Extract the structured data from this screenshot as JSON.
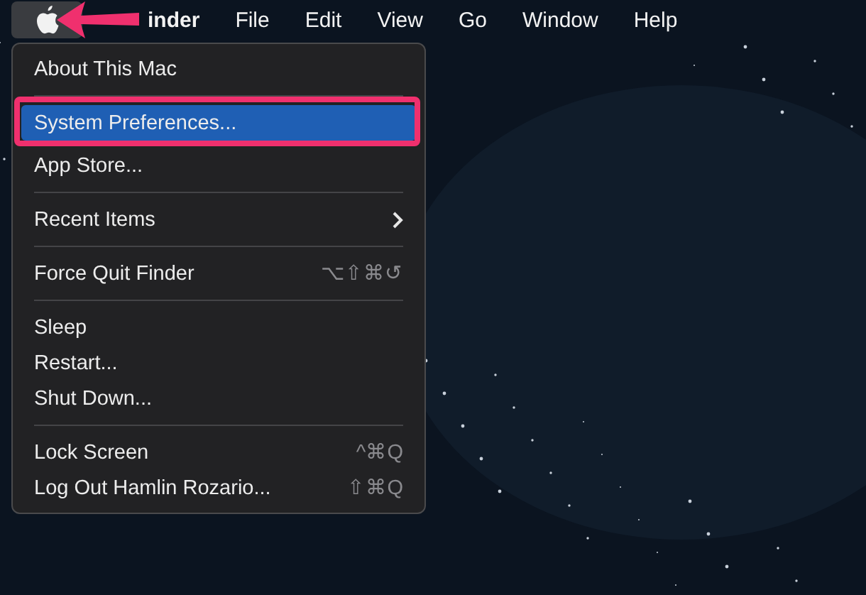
{
  "menu_bar": {
    "apple_selected": true,
    "items": [
      {
        "label": "inder",
        "bold": true
      },
      {
        "label": "File",
        "bold": false
      },
      {
        "label": "Edit",
        "bold": false
      },
      {
        "label": "View",
        "bold": false
      },
      {
        "label": "Go",
        "bold": false
      },
      {
        "label": "Window",
        "bold": false
      },
      {
        "label": "Help",
        "bold": false
      }
    ]
  },
  "apple_menu": {
    "items": [
      {
        "kind": "item",
        "label": "About This Mac",
        "selected": false
      },
      {
        "kind": "separator"
      },
      {
        "kind": "item",
        "label": "System Preferences...",
        "selected": true,
        "annotated": true
      },
      {
        "kind": "item",
        "label": "App Store...",
        "selected": false
      },
      {
        "kind": "separator"
      },
      {
        "kind": "submenu",
        "label": "Recent Items",
        "selected": false
      },
      {
        "kind": "separator"
      },
      {
        "kind": "item",
        "label": "Force Quit Finder",
        "shortcut": "⌥⇧⌘↺",
        "selected": false
      },
      {
        "kind": "separator"
      },
      {
        "kind": "item",
        "label": "Sleep",
        "selected": false
      },
      {
        "kind": "item",
        "label": "Restart...",
        "selected": false
      },
      {
        "kind": "item",
        "label": "Shut Down...",
        "selected": false
      },
      {
        "kind": "separator"
      },
      {
        "kind": "item",
        "label": "Lock Screen",
        "shortcut": "^⌘Q",
        "selected": false
      },
      {
        "kind": "item",
        "label": "Log Out Hamlin Rozario...",
        "shortcut": "⇧⌘Q",
        "selected": false
      }
    ]
  }
}
